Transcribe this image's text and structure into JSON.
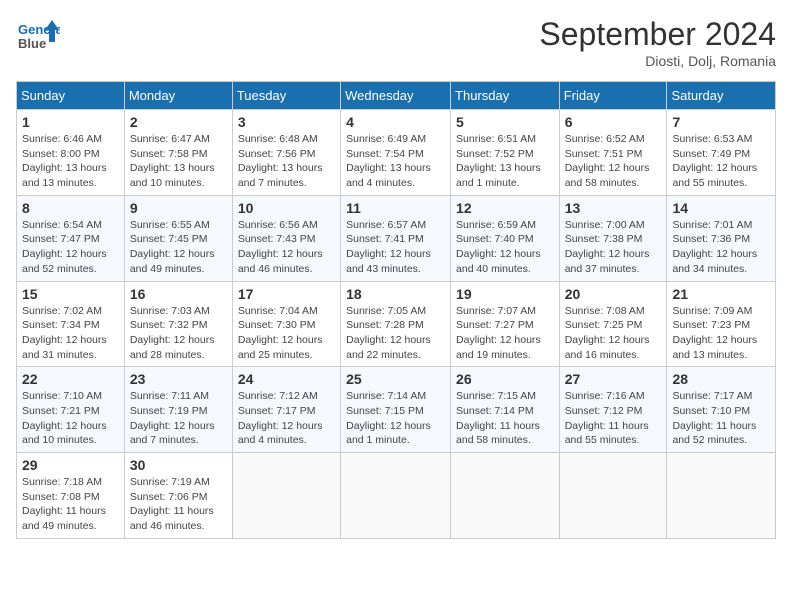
{
  "header": {
    "logo_line1": "General",
    "logo_line2": "Blue",
    "month": "September 2024",
    "location": "Diosti, Dolj, Romania"
  },
  "weekdays": [
    "Sunday",
    "Monday",
    "Tuesday",
    "Wednesday",
    "Thursday",
    "Friday",
    "Saturday"
  ],
  "weeks": [
    [
      {
        "day": "1",
        "info": "Sunrise: 6:46 AM\nSunset: 8:00 PM\nDaylight: 13 hours\nand 13 minutes."
      },
      {
        "day": "2",
        "info": "Sunrise: 6:47 AM\nSunset: 7:58 PM\nDaylight: 13 hours\nand 10 minutes."
      },
      {
        "day": "3",
        "info": "Sunrise: 6:48 AM\nSunset: 7:56 PM\nDaylight: 13 hours\nand 7 minutes."
      },
      {
        "day": "4",
        "info": "Sunrise: 6:49 AM\nSunset: 7:54 PM\nDaylight: 13 hours\nand 4 minutes."
      },
      {
        "day": "5",
        "info": "Sunrise: 6:51 AM\nSunset: 7:52 PM\nDaylight: 13 hours\nand 1 minute."
      },
      {
        "day": "6",
        "info": "Sunrise: 6:52 AM\nSunset: 7:51 PM\nDaylight: 12 hours\nand 58 minutes."
      },
      {
        "day": "7",
        "info": "Sunrise: 6:53 AM\nSunset: 7:49 PM\nDaylight: 12 hours\nand 55 minutes."
      }
    ],
    [
      {
        "day": "8",
        "info": "Sunrise: 6:54 AM\nSunset: 7:47 PM\nDaylight: 12 hours\nand 52 minutes."
      },
      {
        "day": "9",
        "info": "Sunrise: 6:55 AM\nSunset: 7:45 PM\nDaylight: 12 hours\nand 49 minutes."
      },
      {
        "day": "10",
        "info": "Sunrise: 6:56 AM\nSunset: 7:43 PM\nDaylight: 12 hours\nand 46 minutes."
      },
      {
        "day": "11",
        "info": "Sunrise: 6:57 AM\nSunset: 7:41 PM\nDaylight: 12 hours\nand 43 minutes."
      },
      {
        "day": "12",
        "info": "Sunrise: 6:59 AM\nSunset: 7:40 PM\nDaylight: 12 hours\nand 40 minutes."
      },
      {
        "day": "13",
        "info": "Sunrise: 7:00 AM\nSunset: 7:38 PM\nDaylight: 12 hours\nand 37 minutes."
      },
      {
        "day": "14",
        "info": "Sunrise: 7:01 AM\nSunset: 7:36 PM\nDaylight: 12 hours\nand 34 minutes."
      }
    ],
    [
      {
        "day": "15",
        "info": "Sunrise: 7:02 AM\nSunset: 7:34 PM\nDaylight: 12 hours\nand 31 minutes."
      },
      {
        "day": "16",
        "info": "Sunrise: 7:03 AM\nSunset: 7:32 PM\nDaylight: 12 hours\nand 28 minutes."
      },
      {
        "day": "17",
        "info": "Sunrise: 7:04 AM\nSunset: 7:30 PM\nDaylight: 12 hours\nand 25 minutes."
      },
      {
        "day": "18",
        "info": "Sunrise: 7:05 AM\nSunset: 7:28 PM\nDaylight: 12 hours\nand 22 minutes."
      },
      {
        "day": "19",
        "info": "Sunrise: 7:07 AM\nSunset: 7:27 PM\nDaylight: 12 hours\nand 19 minutes."
      },
      {
        "day": "20",
        "info": "Sunrise: 7:08 AM\nSunset: 7:25 PM\nDaylight: 12 hours\nand 16 minutes."
      },
      {
        "day": "21",
        "info": "Sunrise: 7:09 AM\nSunset: 7:23 PM\nDaylight: 12 hours\nand 13 minutes."
      }
    ],
    [
      {
        "day": "22",
        "info": "Sunrise: 7:10 AM\nSunset: 7:21 PM\nDaylight: 12 hours\nand 10 minutes."
      },
      {
        "day": "23",
        "info": "Sunrise: 7:11 AM\nSunset: 7:19 PM\nDaylight: 12 hours\nand 7 minutes."
      },
      {
        "day": "24",
        "info": "Sunrise: 7:12 AM\nSunset: 7:17 PM\nDaylight: 12 hours\nand 4 minutes."
      },
      {
        "day": "25",
        "info": "Sunrise: 7:14 AM\nSunset: 7:15 PM\nDaylight: 12 hours\nand 1 minute."
      },
      {
        "day": "26",
        "info": "Sunrise: 7:15 AM\nSunset: 7:14 PM\nDaylight: 11 hours\nand 58 minutes."
      },
      {
        "day": "27",
        "info": "Sunrise: 7:16 AM\nSunset: 7:12 PM\nDaylight: 11 hours\nand 55 minutes."
      },
      {
        "day": "28",
        "info": "Sunrise: 7:17 AM\nSunset: 7:10 PM\nDaylight: 11 hours\nand 52 minutes."
      }
    ],
    [
      {
        "day": "29",
        "info": "Sunrise: 7:18 AM\nSunset: 7:08 PM\nDaylight: 11 hours\nand 49 minutes."
      },
      {
        "day": "30",
        "info": "Sunrise: 7:19 AM\nSunset: 7:06 PM\nDaylight: 11 hours\nand 46 minutes."
      },
      {
        "day": "",
        "info": ""
      },
      {
        "day": "",
        "info": ""
      },
      {
        "day": "",
        "info": ""
      },
      {
        "day": "",
        "info": ""
      },
      {
        "day": "",
        "info": ""
      }
    ]
  ]
}
